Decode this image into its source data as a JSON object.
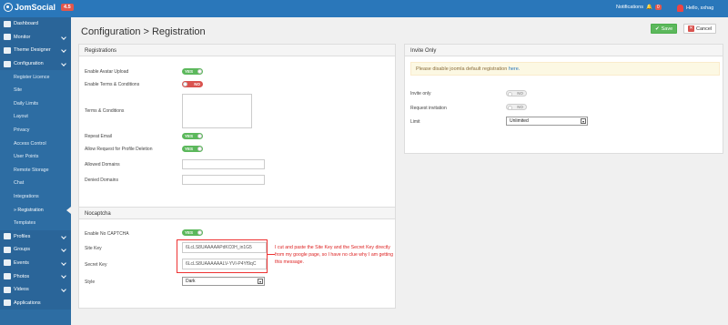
{
  "topbar": {
    "app_name": "JomSocial",
    "version": "4.5",
    "notifications_label": "Notifications",
    "notifications_count": "0",
    "user_greeting": "Hello, sxhag"
  },
  "sidebar": {
    "items": [
      {
        "label": "Dashboard",
        "icon": "dashboard-icon",
        "type": "section"
      },
      {
        "label": "Monitor",
        "icon": "monitor-icon",
        "type": "section"
      },
      {
        "label": "Theme Designer",
        "icon": "paint-icon",
        "type": "section"
      },
      {
        "label": "Configuration",
        "icon": "gear-icon",
        "type": "section"
      },
      {
        "label": "Register Licence",
        "type": "sub"
      },
      {
        "label": "Site",
        "type": "sub"
      },
      {
        "label": "Daily Limits",
        "type": "sub"
      },
      {
        "label": "Layout",
        "type": "sub"
      },
      {
        "label": "Privacy",
        "type": "sub"
      },
      {
        "label": "Access Control",
        "type": "sub"
      },
      {
        "label": "User Points",
        "type": "sub"
      },
      {
        "label": "Remote Storage",
        "type": "sub"
      },
      {
        "label": "Chat",
        "type": "sub"
      },
      {
        "label": "Integrations",
        "type": "sub"
      },
      {
        "label": "» Registration",
        "type": "sub",
        "active": true
      },
      {
        "label": "Templates",
        "type": "sub"
      },
      {
        "label": "Profiles",
        "icon": "user-icon",
        "type": "section"
      },
      {
        "label": "Groups",
        "icon": "users-icon",
        "type": "section"
      },
      {
        "label": "Events",
        "icon": "calendar-icon",
        "type": "section"
      },
      {
        "label": "Photos",
        "icon": "camera-icon",
        "type": "section"
      },
      {
        "label": "Videos",
        "icon": "video-icon",
        "type": "section"
      },
      {
        "label": "Applications",
        "icon": "cube-icon",
        "type": "section"
      }
    ]
  },
  "page": {
    "title": "Configuration > Registration",
    "save_label": "Save",
    "cancel_label": "Cancel"
  },
  "registrations": {
    "heading": "Registrations",
    "enable_avatar_label": "Enable Avatar Upload",
    "enable_avatar_value": "YES",
    "enable_terms_label": "Enable Terms & Conditions",
    "enable_terms_value": "NO",
    "terms_label": "Terms & Conditions",
    "terms_value": "",
    "repeat_email_label": "Repeat Email",
    "repeat_email_value": "YES",
    "allow_deletion_label": "Allow Request for Profile Deletion",
    "allow_deletion_value": "YES",
    "allowed_domains_label": "Allowed Domains",
    "allowed_domains_value": "",
    "denied_domains_label": "Denied Domains",
    "denied_domains_value": ""
  },
  "nocaptcha": {
    "heading": "Nocaptcha",
    "enable_label": "Enable No CAPTCHA",
    "enable_value": "YES",
    "site_key_label": "Site Key",
    "site_key_value": "6LcLS8UAAAAAPdKC0H_in1G5",
    "secret_key_label": "Secret Key",
    "secret_key_value": "6LcLS8UAAAAAALV-YVI-P4Yf9qC",
    "style_label": "Style",
    "style_value": "Dark"
  },
  "invite_only": {
    "heading": "Invite Only",
    "alert_text": "Please disable joomla default registration",
    "alert_link": "here.",
    "invite_only_label": "Invite only",
    "invite_only_value": "NO",
    "request_invitation_label": "Request invitation",
    "request_invitation_value": "NO",
    "limit_label": "Limit",
    "limit_value": "Unlimited"
  },
  "annotation": {
    "text": "I cut and paste the Site Key and the Secret Key directly from my google page, so I have no clue why I am getting this message."
  },
  "colors": {
    "topbar": "#2a77ba",
    "sidebar": "#2d6da3",
    "toggle_yes": "#5cb85c",
    "toggle_no": "#d9534f",
    "annotation": "#e33333"
  }
}
